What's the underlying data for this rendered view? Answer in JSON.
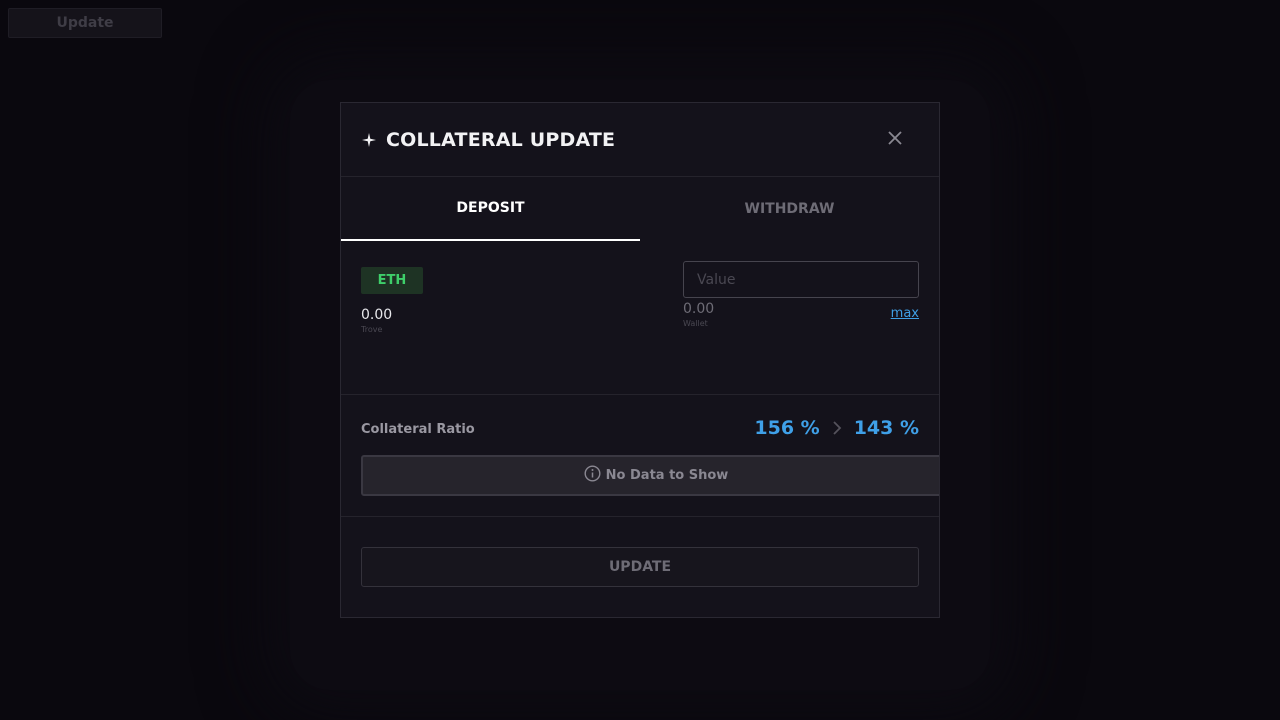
{
  "page": {
    "update_label": "Update"
  },
  "modal": {
    "title": "COLLATERAL UPDATE",
    "tabs": [
      {
        "label": "DEPOSIT",
        "active": true
      },
      {
        "label": "WITHDRAW",
        "active": false
      }
    ],
    "asset": {
      "symbol": "ETH",
      "trove_value": "0.00",
      "trove_label": "Trove",
      "input_placeholder": "Value",
      "wallet_value": "0.00",
      "wallet_label": "Wallet",
      "max_label": "max"
    },
    "ratio": {
      "label": "Collateral Ratio",
      "current": "156 %",
      "next": "143 %",
      "no_data": "No Data to Show"
    },
    "update_label": "UPDATE"
  },
  "colors": {
    "accent_blue": "#3fa0e8",
    "eth_green": "#3ecf6a"
  }
}
